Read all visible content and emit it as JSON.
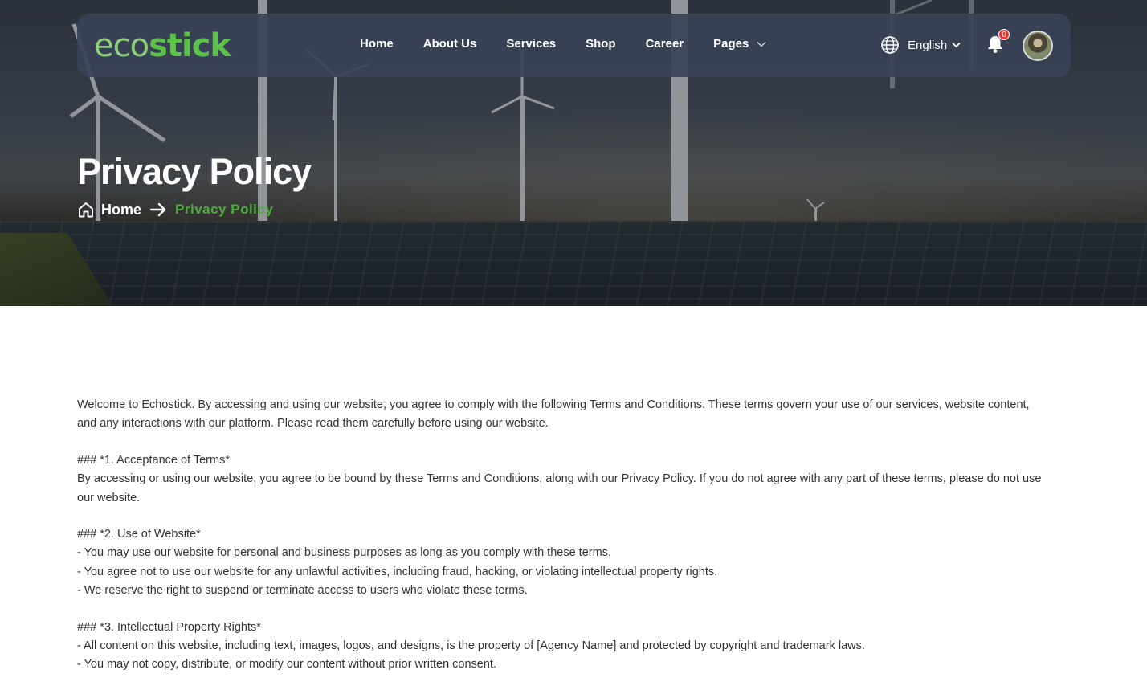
{
  "brand": {
    "logo_eco": "eco",
    "logo_stick": "stick",
    "colors": {
      "logo_light": "#8ed07a",
      "logo_dark": "#5cc24a",
      "accent": "#4caf3c",
      "navbar": "#3a4256"
    }
  },
  "nav": {
    "items": [
      {
        "label": "Home"
      },
      {
        "label": "About Us"
      },
      {
        "label": "Services"
      },
      {
        "label": "Shop"
      },
      {
        "label": "Career"
      },
      {
        "label": "Pages"
      }
    ],
    "language": "English",
    "notification_count": "0",
    "icons": {
      "language": "globe-icon",
      "notifications": "bell-icon",
      "pages_dropdown": "chevron-down-icon"
    }
  },
  "hero": {
    "title": "Privacy Policy",
    "breadcrumb": {
      "home": "Home",
      "current": "Privacy Policy"
    }
  },
  "content": {
    "intro": [
      "Welcome to Echostick. By accessing and using our website, you agree to comply with the following Terms and Conditions. These terms govern your use of our services, website content,",
      "and any interactions with our platform. Please read them carefully before using our website."
    ],
    "sections": [
      {
        "heading": "### *1. Acceptance of Terms*",
        "lines": [
          "By accessing or using our website, you agree to be bound by these Terms and Conditions, along with our Privacy Policy. If you do not agree with any part of these terms, please do not use",
          "our website."
        ]
      },
      {
        "heading": "### *2. Use of Website*",
        "lines": [
          "- You may use our website for personal and business purposes as long as you comply with these terms.",
          "- You agree not to use our website for any unlawful activities, including fraud, hacking, or violating intellectual property rights.",
          "- We reserve the right to suspend or terminate access to users who violate these terms."
        ]
      },
      {
        "heading": "### *3. Intellectual Property Rights*",
        "lines": [
          "- All content on this website, including text, images, logos, and designs, is the property of [Agency Name] and protected by copyright and trademark laws.",
          "- You may not copy, distribute, or modify our content without prior written consent."
        ]
      }
    ]
  }
}
